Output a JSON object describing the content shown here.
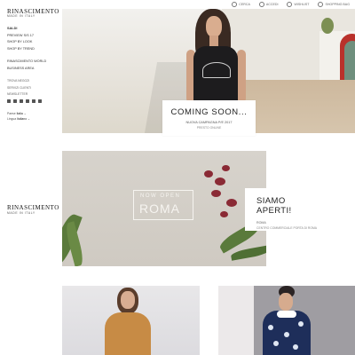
{
  "brand": {
    "name": "RINASCIMENTO",
    "tagline": "MADE IN ITALY"
  },
  "top_links": [
    "CERCA",
    "ACCEDI",
    "WISHLIST",
    "SHOPPING BAG"
  ],
  "sidebar": {
    "items_group1": [
      {
        "label": "SALDI",
        "active": true
      },
      {
        "label": "PREVIEW S/S 17"
      },
      {
        "label": "SHOP BY LOOK"
      },
      {
        "label": "SHOP BY TREND"
      }
    ],
    "items_group2": [
      {
        "label": "RINASCIMENTO WORLD"
      },
      {
        "label": "BUSINESS AREA"
      }
    ],
    "items_group3": [
      {
        "label": "TROVA NEGOZI"
      },
      {
        "label": "SERVIZI CLIENTI"
      },
      {
        "label": "NEWSLETTER"
      }
    ],
    "country": {
      "label": "Paese",
      "value": "Italia"
    },
    "language": {
      "label": "Lingua",
      "value": "Italiano"
    }
  },
  "hero1": {
    "title": "COMING SOON...",
    "subtitle": "NUOVA CAMPAGNA P/E 2017",
    "link": "PRESTO ONLINE"
  },
  "hero2": {
    "overlay_line1": "NOW OPEN",
    "overlay_line2": "ROMA",
    "title": "SIAMO APERTI!",
    "subtitle": "ROMA",
    "link": "CENTRO COMMERCIALE PORTA DI ROMA"
  }
}
